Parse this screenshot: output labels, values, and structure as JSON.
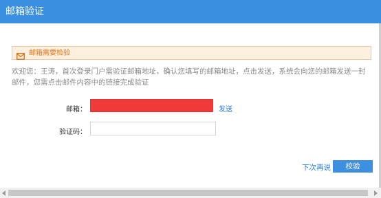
{
  "dialog": {
    "title": "邮箱验证"
  },
  "notice": {
    "text": "邮箱需要检验",
    "icon": "envelope-icon",
    "color": "#e2741b"
  },
  "welcome": {
    "text": "欢迎您：王涛，首次登录门户需验证邮箱地址，确认您填写的邮箱地址，点击发送，系统会向您的邮箱发送一封邮件，您需点击邮件内容中的链接完成验证"
  },
  "form": {
    "email_label": "邮箱：",
    "email_value": "",
    "send_label": "发送",
    "code_label": "验证码：",
    "code_value": ""
  },
  "footer": {
    "later_label": "下次再说",
    "verify_label": "校验"
  },
  "colors": {
    "accent": "#3b8fe0",
    "redacted": "#f03a3a",
    "link": "#2b7ad5"
  }
}
